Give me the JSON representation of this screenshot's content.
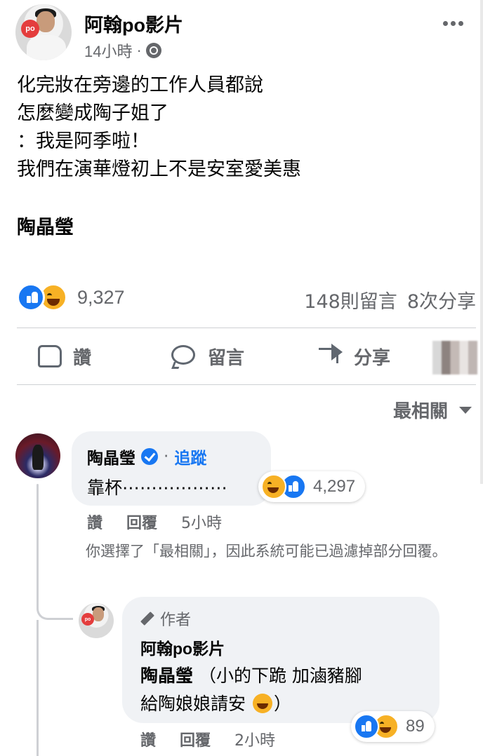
{
  "post": {
    "author": "阿翰po影片",
    "avatar_badge": "po",
    "time": "14小時",
    "privacy_icon": "globe-icon",
    "text_lines": [
      "化完妝在旁邊的工作人員都說",
      "怎麼變成陶子姐了",
      "：我是阿季啦！",
      "我們在演華燈初上不是安室愛美惠"
    ],
    "bold_line": "陶晶瑩",
    "reaction_count": "9,327",
    "comments_count": "148則留言",
    "shares_count": "8次分享"
  },
  "actions": {
    "like": "讚",
    "comment": "留言",
    "share": "分享"
  },
  "sort": {
    "label": "最相關"
  },
  "comments": [
    {
      "name": "陶晶瑩",
      "separator": "·",
      "follow": "追蹤",
      "text": "靠杯⋯⋯⋯⋯⋯⋯",
      "reaction_count": "4,297",
      "like_label": "讚",
      "reply_label": "回覆",
      "time": "5小時"
    }
  ],
  "filter_note": "你選擇了「最相關」，因此系統可能已過濾掉部分回覆。",
  "reply": {
    "author_tag": "作者",
    "name": "阿翰po影片",
    "avatar_badge": "po",
    "mention": "陶晶瑩",
    "text_part1": "（小的下跪 加滷豬腳",
    "text_part2": "給陶娘娘請安",
    "text_part3": "）",
    "reaction_count": "89",
    "like_label": "讚",
    "reply_label": "回覆",
    "time": "2小時"
  },
  "colors": {
    "link_blue": "#1877f2",
    "secondary_text": "#65676b",
    "bubble_bg": "#f0f2f5",
    "haha_yellow": "#f7b125"
  }
}
